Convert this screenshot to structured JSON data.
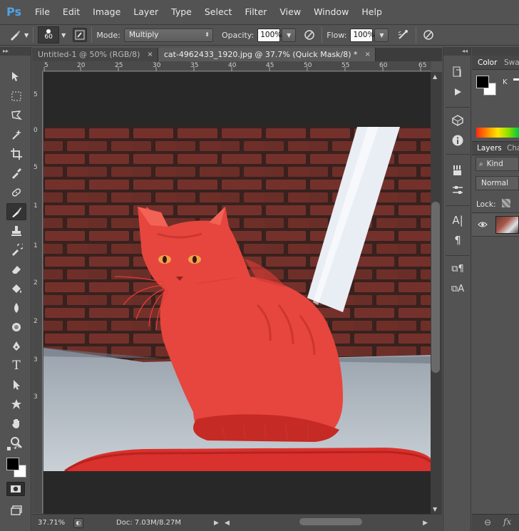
{
  "app": {
    "logo": "Ps"
  },
  "menu": [
    "File",
    "Edit",
    "Image",
    "Layer",
    "Type",
    "Select",
    "Filter",
    "View",
    "Window",
    "Help"
  ],
  "options": {
    "brush_size": "60",
    "mode_label": "Mode:",
    "mode_value": "Multiply",
    "opacity_label": "Opacity:",
    "opacity_value": "100%",
    "flow_label": "Flow:",
    "flow_value": "100%"
  },
  "tabs": [
    {
      "label": "Untitled-1 @ 50% (RGB/8)",
      "close": "×"
    },
    {
      "label": "cat-4962433_1920.jpg @ 37.7% (Quick Mask/8) *",
      "close": "×"
    }
  ],
  "rulers": {
    "top": [
      "5",
      "20",
      "25",
      "30",
      "35",
      "40",
      "45",
      "50",
      "55",
      "60",
      "65"
    ],
    "left": [
      "5",
      "0",
      "5",
      "1",
      "1",
      "2",
      "2",
      "3",
      "3"
    ]
  },
  "status": {
    "zoom": "37.71%",
    "doc": "Doc: 7.03M/8.27M"
  },
  "panels": {
    "color_tab": "Color",
    "swatches_tab": "Swa",
    "k_label": "K",
    "layers_tab": "Layers",
    "channels_tab": "Cha",
    "kind_label": "Kind",
    "blend_mode": "Normal",
    "lock_label": "Lock:"
  },
  "colors": {
    "foreground": "#000000",
    "background": "#ffffff",
    "quickmask_overlay": "#e0312e",
    "ui_bg": "#535353"
  }
}
